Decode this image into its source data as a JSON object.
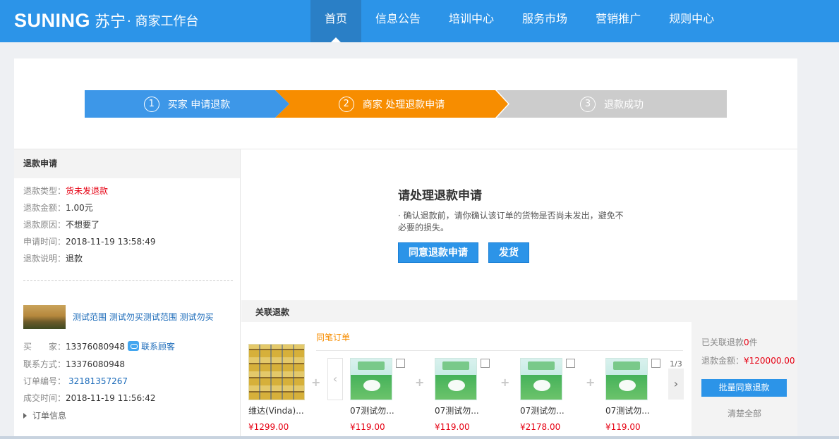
{
  "header": {
    "logo_text": "SUNING",
    "logo_cn": "苏宁",
    "logo_sub": "· 商家工作台",
    "nav": [
      {
        "label": "首页",
        "active": true
      },
      {
        "label": "信息公告"
      },
      {
        "label": "培训中心"
      },
      {
        "label": "服务市场"
      },
      {
        "label": "营销推广"
      },
      {
        "label": "规则中心"
      }
    ]
  },
  "steps": [
    {
      "num": "1",
      "label": "买家 申请退款",
      "color": "#3d97e8"
    },
    {
      "num": "2",
      "label": "商家 处理退款申请",
      "color": "#f78d00"
    },
    {
      "num": "3",
      "label": "退款成功",
      "color": "#cccccc"
    }
  ],
  "refund": {
    "title": "退款申请",
    "type_key": "退款类型：",
    "type_val": "货未发退款",
    "amount_key": "退款金额：",
    "amount_val": "1.00元",
    "reason_key": "退款原因：",
    "reason_val": "不想要了",
    "time_key": "申请时间：",
    "time_val": "2018-11-19 13:58:49",
    "desc_key": "退款说明：",
    "desc_val": "退款"
  },
  "goods": {
    "link": "测试范围 测试勿买测试范围 测试勿买",
    "buyer_key": "买　　家：",
    "buyer_val": "13376080948",
    "contact_service": "联系顾客",
    "contact_key": "联系方式：",
    "contact_val": "13376080948",
    "order_key": "订单编号：",
    "order_val": "32181357267",
    "deal_key": "成交时间：",
    "deal_val": "2018-11-19 11:56:42",
    "order_info": "订单信息"
  },
  "notice": {
    "title": "请处理退款申请",
    "text": "· 确认退款前，请你确认该订单的货物是否尚未发出，避免不必要的损失。",
    "agree_btn": "同意退款申请",
    "ship_btn": "发货"
  },
  "related": {
    "title": "关联退款",
    "same_order": "同笔订单",
    "page": "1/3",
    "products": [
      {
        "name": "维达(Vinda)...",
        "price": "¥1299.00"
      },
      {
        "name": "07测试勿...",
        "price": "¥119.00"
      },
      {
        "name": "07测试勿...",
        "price": "¥119.00"
      },
      {
        "name": "07测试勿...",
        "price": "¥2178.00"
      },
      {
        "name": "07测试勿...",
        "price": "¥119.00"
      }
    ],
    "linked_prefix": "已关联退款",
    "linked_count": "0",
    "linked_suffix": "件",
    "amount_key": "退款金额：",
    "amount_val": "¥120000.00",
    "batch_btn": "批量同意退款",
    "clear_all": "清楚全部"
  },
  "colors": {
    "header_bg": "#2c94e8",
    "nav_active": "#2a7fc6",
    "price_red": "#e60012",
    "step_orange": "#f78d00"
  }
}
